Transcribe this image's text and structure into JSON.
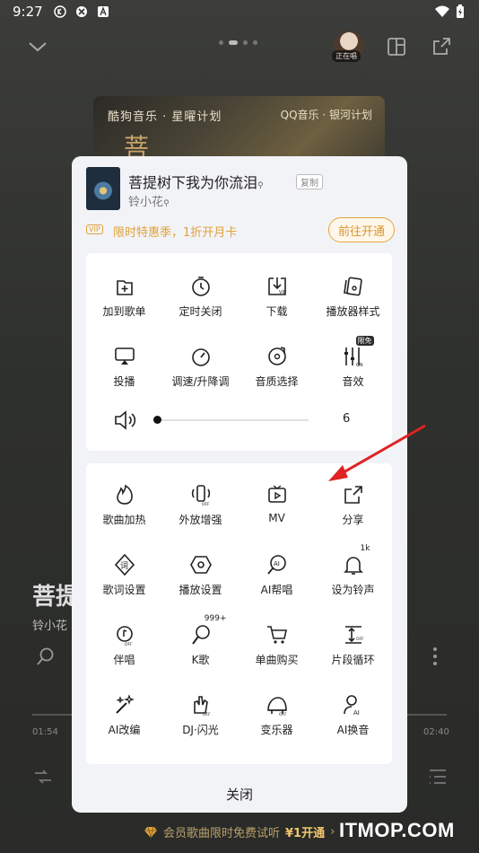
{
  "status_bar": {
    "time": "9:27",
    "icons": [
      "k-app-icon",
      "app-icon",
      "a-icon",
      "wifi-icon",
      "battery-icon"
    ]
  },
  "player": {
    "now_playing_label": "正在唱",
    "cover_text_left": "酷狗音乐 · 星曜计划",
    "cover_text_right": "QQ音乐 · 银河计划",
    "cover_glyph": "菩",
    "bg_song_title": "菩提",
    "bg_singer": "铃小花",
    "time_current": "01:54",
    "time_total": "02:40",
    "promo_text": "会员歌曲限时免费试听",
    "promo_price": "¥1开通",
    "promo_chevron": "›",
    "watermark": "ITMOP.COM"
  },
  "modal": {
    "song_title": "菩提树下我为你流泪",
    "copy_label": "复制",
    "singer": "铃小花",
    "vip_badge": "VIP",
    "vip_text": "限时特惠季，1折开月卡",
    "vip_button": "前往开通",
    "card1_items": [
      {
        "label": "加到歌单",
        "icon": "add-to-playlist-icon"
      },
      {
        "label": "定时关闭",
        "icon": "timer-icon"
      },
      {
        "label": "下载",
        "icon": "download-vip-icon"
      },
      {
        "label": "播放器样式",
        "icon": "player-style-icon"
      },
      {
        "label": "投播",
        "icon": "cast-icon"
      },
      {
        "label": "调速/升降调",
        "icon": "speed-icon"
      },
      {
        "label": "音质选择",
        "icon": "quality-icon"
      },
      {
        "label": "音效",
        "icon": "sound-effect-icon",
        "tag": "限免"
      }
    ],
    "volume": {
      "value": "6",
      "level": 0.0
    },
    "card2_items": [
      {
        "label": "歌曲加热",
        "icon": "heat-icon"
      },
      {
        "label": "外放增强",
        "icon": "speaker-boost-icon"
      },
      {
        "label": "MV",
        "icon": "mv-icon"
      },
      {
        "label": "分享",
        "icon": "share-icon"
      },
      {
        "label": "歌词设置",
        "icon": "lyrics-settings-icon"
      },
      {
        "label": "播放设置",
        "icon": "play-settings-icon"
      },
      {
        "label": "AI帮唱",
        "icon": "ai-sing-icon"
      },
      {
        "label": "设为铃声",
        "icon": "ringtone-icon",
        "tag": "1k"
      },
      {
        "label": "伴唱",
        "icon": "accompany-icon"
      },
      {
        "label": "K歌",
        "icon": "karaoke-icon",
        "tag": "999+"
      },
      {
        "label": "单曲购买",
        "icon": "cart-icon"
      },
      {
        "label": "片段循环",
        "icon": "segment-loop-icon"
      },
      {
        "label": "AI改编",
        "icon": "ai-remix-icon"
      },
      {
        "label": "DJ·闪光",
        "icon": "dj-icon"
      },
      {
        "label": "变乐器",
        "icon": "instrument-icon"
      },
      {
        "label": "AI换音",
        "icon": "ai-voice-icon"
      }
    ],
    "close_label": "关闭"
  },
  "colors": {
    "accent_gold": "#e0a13a",
    "annotation_red": "#e02222"
  }
}
